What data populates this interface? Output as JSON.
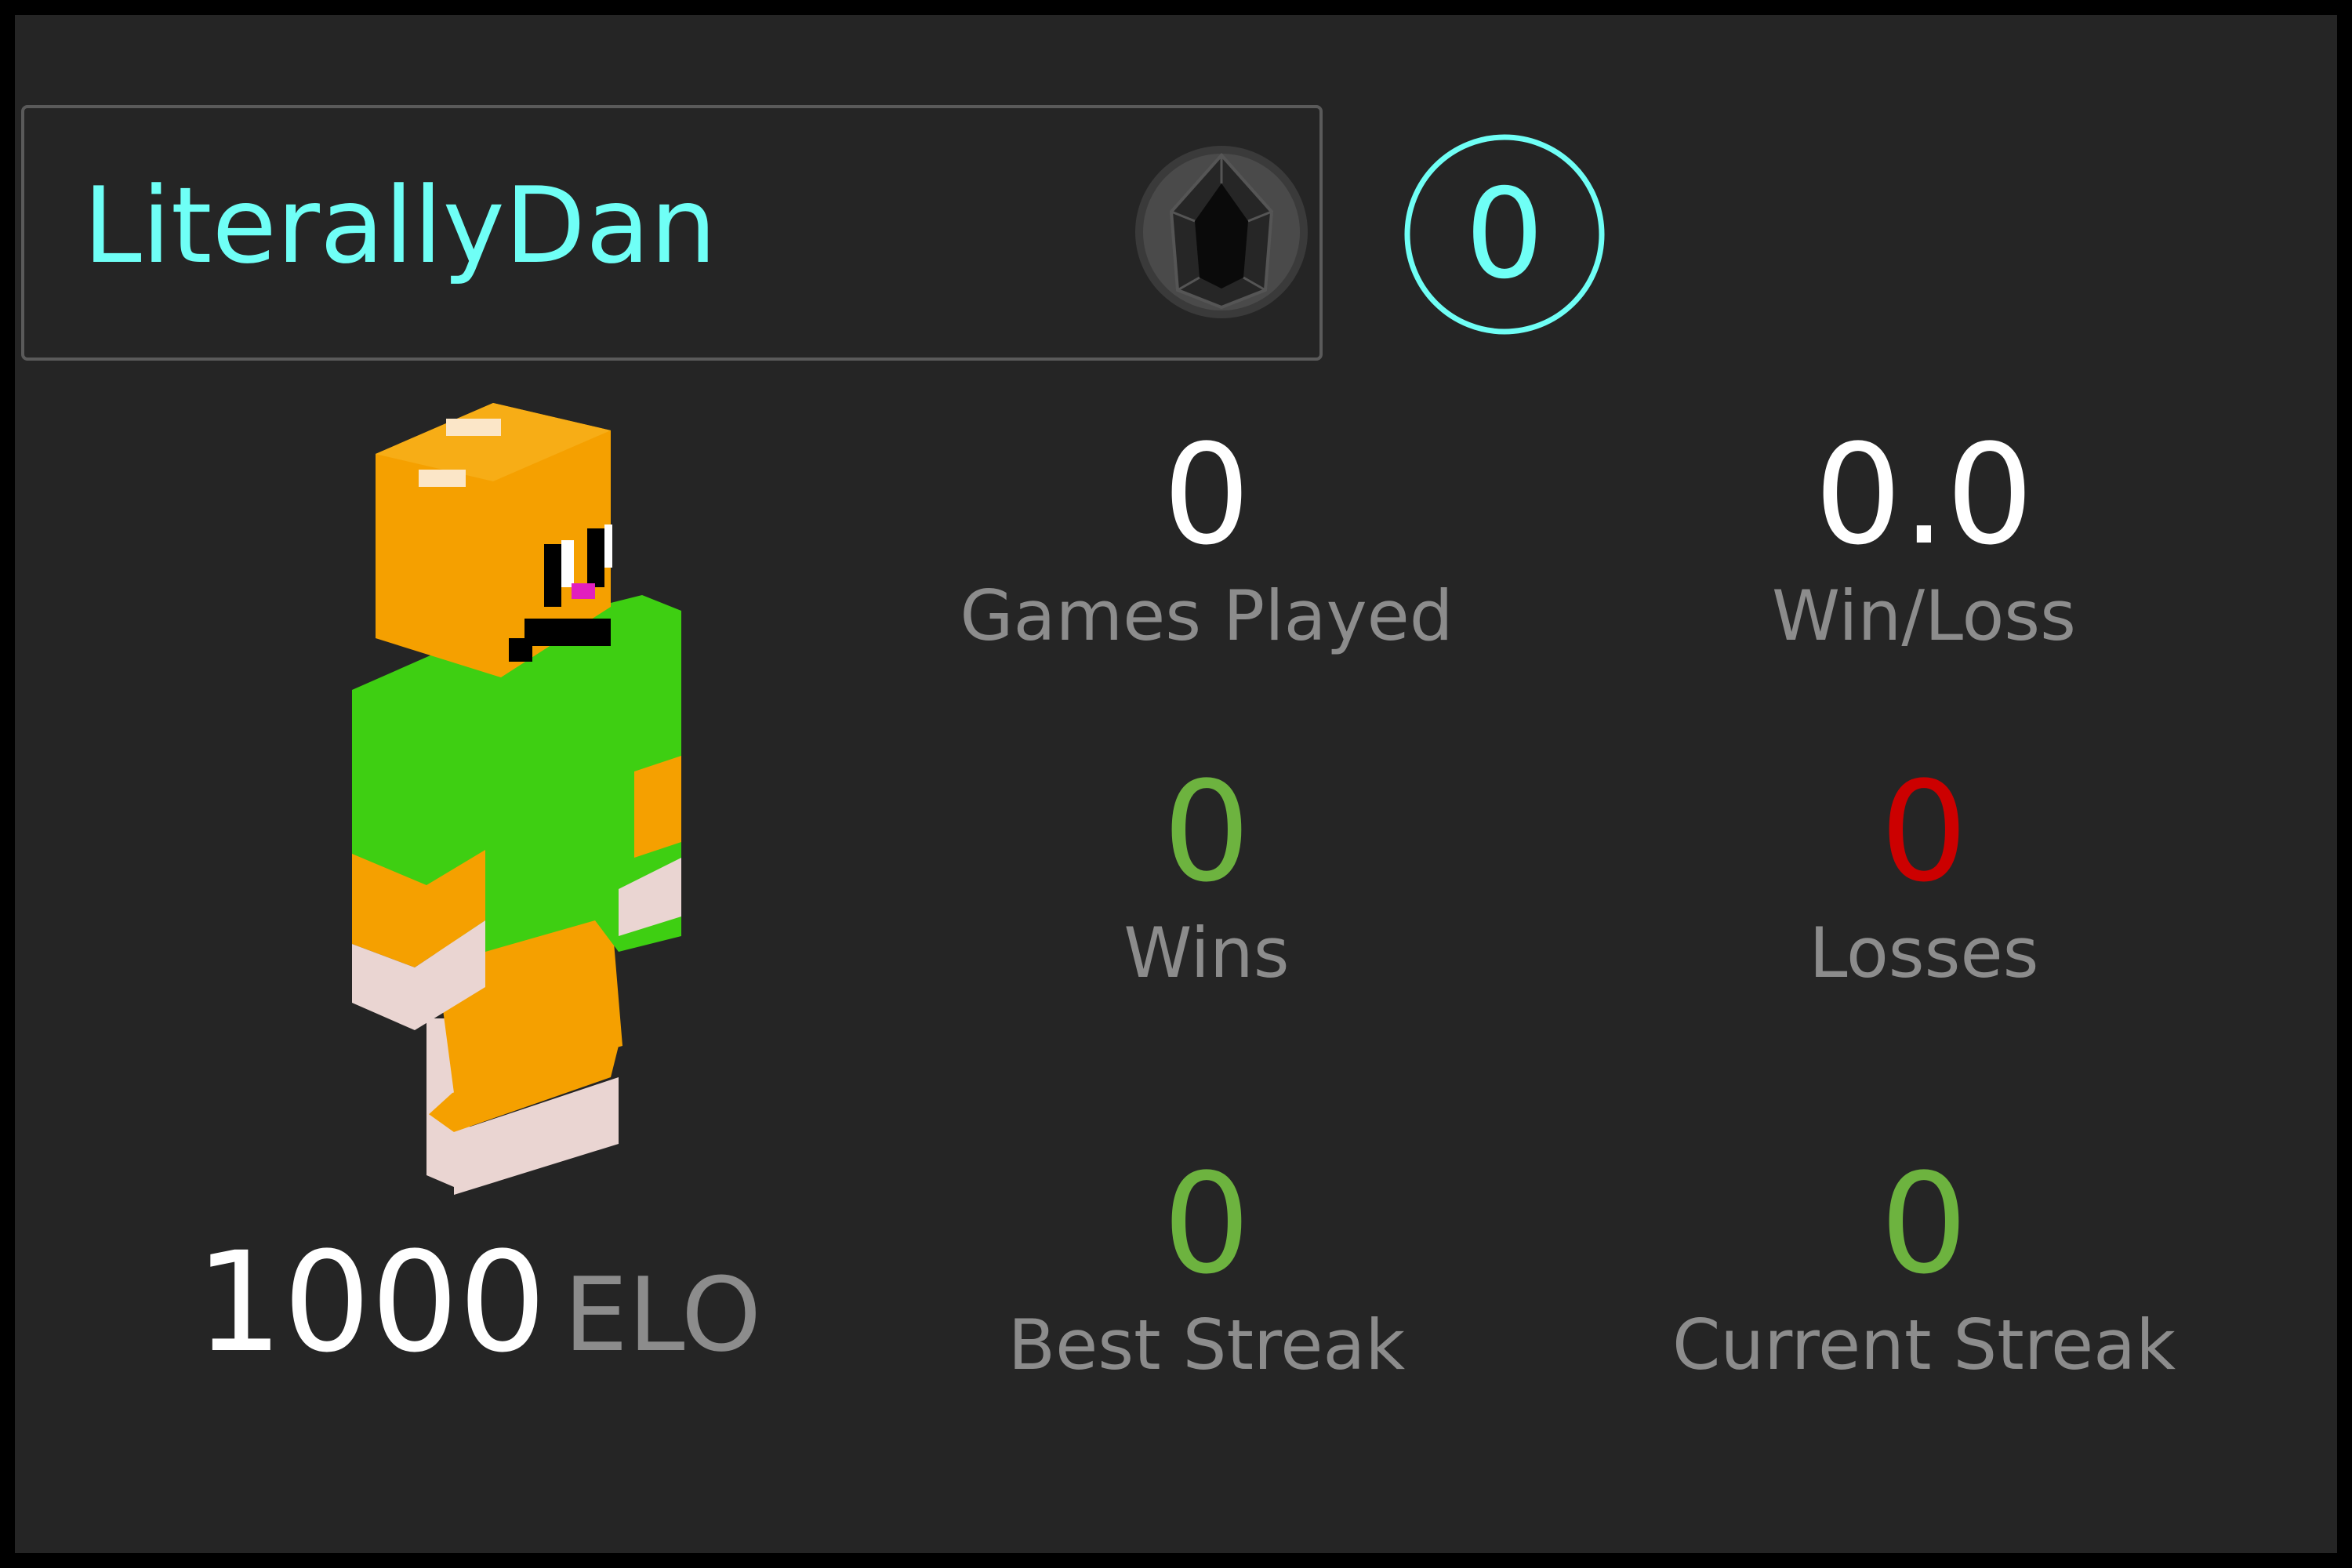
{
  "player": {
    "name": "LiterallyDan",
    "rank_icon": "black-gem-icon",
    "level": "0",
    "elo_value": "1000",
    "elo_label": "ELO",
    "avatar": "minecraft-skin-avatar"
  },
  "stats": {
    "games_played": {
      "value": "0",
      "label": "Games Played"
    },
    "win_loss": {
      "value": "0.0",
      "label": "Win/Loss"
    },
    "wins": {
      "value": "0",
      "label": "Wins"
    },
    "losses": {
      "value": "0",
      "label": "Losses"
    },
    "best_streak": {
      "value": "0",
      "label": "Best Streak"
    },
    "current_streak": {
      "value": "0",
      "label": "Current Streak"
    }
  },
  "colors": {
    "background": "#252525",
    "accent_cyan": "#6ffff6",
    "win_green": "#6db33f",
    "loss_red": "#cc0000",
    "label_gray": "#8c8c8c"
  }
}
